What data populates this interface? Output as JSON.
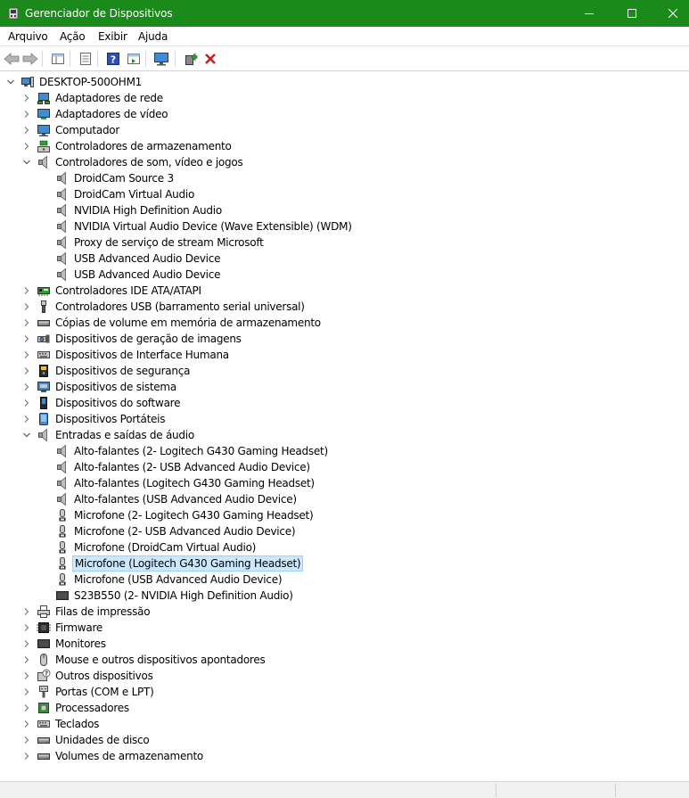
{
  "window": {
    "title": "Gerenciador de Dispositivos"
  },
  "menu": [
    "Arquivo",
    "Ação",
    "Exibir",
    "Ajuda"
  ],
  "tree": {
    "root": "DESKTOP-500OHM1",
    "nodes": [
      {
        "label": "Adaptadores de rede",
        "icon": "network-adapter-icon",
        "level": 1,
        "state": "collapsed"
      },
      {
        "label": "Adaptadores de vídeo",
        "icon": "display-adapter-icon",
        "level": 1,
        "state": "collapsed"
      },
      {
        "label": "Computador",
        "icon": "computer-icon",
        "level": 1,
        "state": "collapsed"
      },
      {
        "label": "Controladores de armazenamento",
        "icon": "storage-controller-icon",
        "level": 1,
        "state": "collapsed"
      },
      {
        "label": "Controladores de som, vídeo e jogos",
        "icon": "speaker-icon",
        "level": 1,
        "state": "expanded"
      },
      {
        "label": "DroidCam Source 3",
        "icon": "speaker-icon",
        "level": 2
      },
      {
        "label": "DroidCam Virtual Audio",
        "icon": "speaker-icon",
        "level": 2
      },
      {
        "label": "NVIDIA High Definition Audio",
        "icon": "speaker-icon",
        "level": 2
      },
      {
        "label": "NVIDIA Virtual Audio Device (Wave Extensible) (WDM)",
        "icon": "speaker-icon",
        "level": 2
      },
      {
        "label": "Proxy de serviço de stream Microsoft",
        "icon": "speaker-icon",
        "level": 2
      },
      {
        "label": "USB Advanced Audio Device",
        "icon": "speaker-icon",
        "level": 2
      },
      {
        "label": "USB Advanced Audio Device",
        "icon": "speaker-icon",
        "level": 2
      },
      {
        "label": "Controladores IDE ATA/ATAPI",
        "icon": "ide-controller-icon",
        "level": 1,
        "state": "collapsed"
      },
      {
        "label": "Controladores USB (barramento serial universal)",
        "icon": "usb-icon",
        "level": 1,
        "state": "collapsed"
      },
      {
        "label": "Cópias de volume em memória de armazenamento",
        "icon": "drive-icon",
        "level": 1,
        "state": "collapsed"
      },
      {
        "label": "Dispositivos de geração de imagens",
        "icon": "camera-icon",
        "level": 1,
        "state": "collapsed"
      },
      {
        "label": "Dispositivos de Interface Humana",
        "icon": "keyboard-icon",
        "level": 1,
        "state": "collapsed"
      },
      {
        "label": "Dispositivos de segurança",
        "icon": "security-device-icon",
        "level": 1,
        "state": "collapsed"
      },
      {
        "label": "Dispositivos de sistema",
        "icon": "system-device-icon",
        "level": 1,
        "state": "collapsed"
      },
      {
        "label": "Dispositivos do software",
        "icon": "software-device-icon",
        "level": 1,
        "state": "collapsed"
      },
      {
        "label": "Dispositivos Portáteis",
        "icon": "portable-device-icon",
        "level": 1,
        "state": "collapsed"
      },
      {
        "label": "Entradas e saídas de áudio",
        "icon": "speaker-icon",
        "level": 1,
        "state": "expanded"
      },
      {
        "label": "Alto-falantes (2- Logitech G430 Gaming Headset)",
        "icon": "speaker-icon",
        "level": 2
      },
      {
        "label": "Alto-falantes (2- USB Advanced Audio Device)",
        "icon": "speaker-icon",
        "level": 2
      },
      {
        "label": "Alto-falantes (Logitech G430 Gaming Headset)",
        "icon": "speaker-icon",
        "level": 2
      },
      {
        "label": "Alto-falantes (USB Advanced Audio Device)",
        "icon": "speaker-icon",
        "level": 2
      },
      {
        "label": "Microfone (2- Logitech G430 Gaming Headset)",
        "icon": "microphone-icon",
        "level": 2
      },
      {
        "label": "Microfone (2- USB Advanced Audio Device)",
        "icon": "microphone-icon",
        "level": 2
      },
      {
        "label": "Microfone (DroidCam Virtual Audio)",
        "icon": "microphone-icon",
        "level": 2
      },
      {
        "label": "Microfone (Logitech G430 Gaming Headset)",
        "icon": "microphone-icon",
        "level": 2,
        "selected": true
      },
      {
        "label": "Microfone (USB Advanced Audio Device)",
        "icon": "microphone-icon",
        "level": 2
      },
      {
        "label": "S23B550 (2- NVIDIA High Definition Audio)",
        "icon": "monitor-icon",
        "level": 2
      },
      {
        "label": "Filas de impressão",
        "icon": "printer-icon",
        "level": 1,
        "state": "collapsed"
      },
      {
        "label": "Firmware",
        "icon": "firmware-icon",
        "level": 1,
        "state": "collapsed"
      },
      {
        "label": "Monitores",
        "icon": "monitor-icon",
        "level": 1,
        "state": "collapsed"
      },
      {
        "label": "Mouse e outros dispositivos apontadores",
        "icon": "mouse-icon",
        "level": 1,
        "state": "collapsed"
      },
      {
        "label": "Outros dispositivos",
        "icon": "unknown-device-icon",
        "level": 1,
        "state": "collapsed"
      },
      {
        "label": "Portas (COM e LPT)",
        "icon": "port-icon",
        "level": 1,
        "state": "collapsed"
      },
      {
        "label": "Processadores",
        "icon": "processor-icon",
        "level": 1,
        "state": "collapsed"
      },
      {
        "label": "Teclados",
        "icon": "keyboard-icon",
        "level": 1,
        "state": "collapsed"
      },
      {
        "label": "Unidades de disco",
        "icon": "drive-icon",
        "level": 1,
        "state": "collapsed"
      },
      {
        "label": "Volumes de armazenamento",
        "icon": "drive-icon",
        "level": 1,
        "state": "collapsed"
      }
    ]
  }
}
